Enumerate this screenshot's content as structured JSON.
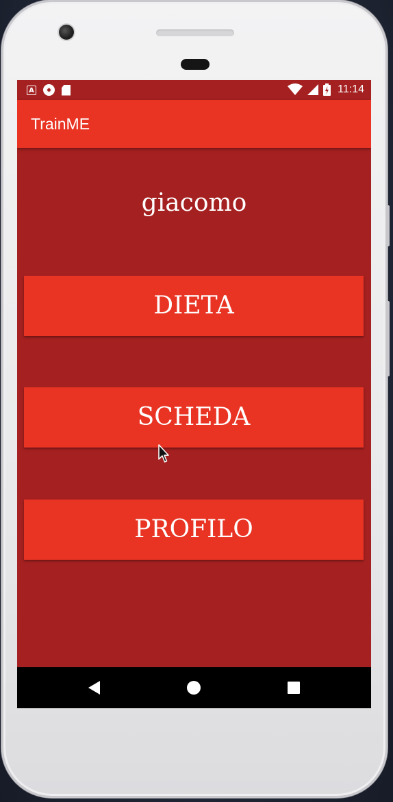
{
  "status_bar": {
    "time": "11:14",
    "left_icons": [
      "a-notification-icon",
      "record-icon",
      "sd-card-icon"
    ],
    "right_icons": [
      "wifi-icon",
      "signal-icon",
      "battery-charging-icon"
    ]
  },
  "app_bar": {
    "title": "TrainME"
  },
  "main": {
    "username": "giacomo",
    "buttons": {
      "dieta": "DIETA",
      "scheda": "SCHEDA",
      "profilo": "PROFILO"
    }
  },
  "nav_bar": {
    "icons": [
      "back-icon",
      "home-icon",
      "recents-icon"
    ]
  },
  "colors": {
    "background": "#a52020",
    "accent": "#e93424",
    "nav_bar": "#000000",
    "text": "#ffffff"
  }
}
